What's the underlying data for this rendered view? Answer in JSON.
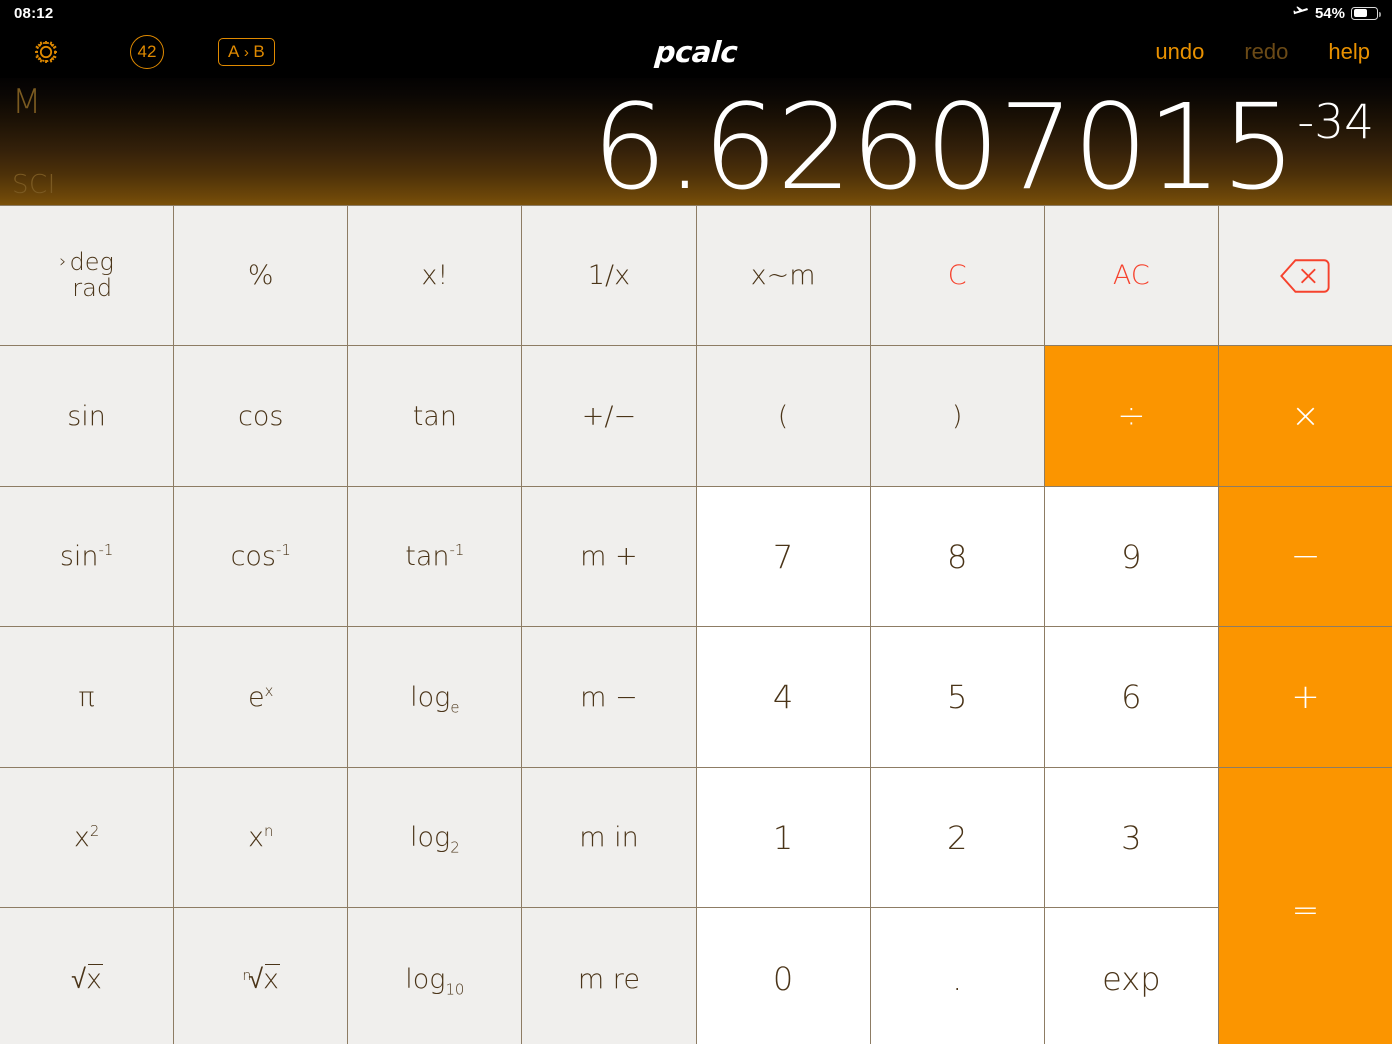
{
  "statusbar": {
    "clock": "08:12",
    "airplane_icon": "airplane-mode-icon",
    "battery_percent": "54%",
    "battery_level": 54
  },
  "toolbar": {
    "gear_icon": "gear-icon",
    "constants_badge": "42",
    "conversion_label_a": "A",
    "conversion_chevron": "›",
    "conversion_label_b": "B",
    "undo_label": "undo",
    "redo_label": "redo",
    "help_label": "help",
    "redo_disabled": true,
    "app_title": "pcalc"
  },
  "display": {
    "memory_indicator": "M",
    "mode_indicator": "SCI",
    "mantissa": "6.62607015",
    "exponent": "-34",
    "full_value": "6.62607015e-34"
  },
  "colors": {
    "accent_orange": "#fb9500",
    "toolbar_orange": "#e99100",
    "clear_red": "#f6422d",
    "key_face": "#f0efed",
    "num_key_face": "#ffffff",
    "key_text": "#4a3418",
    "grid_line": "#8d7c64",
    "display_top": "#030202",
    "display_bottom": "#7a5009"
  },
  "keypad": {
    "rows": [
      [
        {
          "name": "key-deg-rad",
          "type": "func",
          "mode_selected": "deg",
          "mode_other": "rad",
          "chevron": "›"
        },
        {
          "name": "key-percent",
          "type": "func",
          "label": "%"
        },
        {
          "name": "key-factorial",
          "type": "func",
          "label": "x!"
        },
        {
          "name": "key-reciprocal",
          "type": "func",
          "label": "1/x"
        },
        {
          "name": "key-swap-memory",
          "type": "func",
          "label": "x~m"
        },
        {
          "name": "key-clear",
          "type": "func",
          "label": "C",
          "style": "red"
        },
        {
          "name": "key-all-clear",
          "type": "func",
          "label": "AC",
          "style": "red"
        },
        {
          "name": "key-backspace",
          "type": "func",
          "label": "backspace-icon",
          "style": "red"
        }
      ],
      [
        {
          "name": "key-sin",
          "type": "func",
          "label": "sin"
        },
        {
          "name": "key-cos",
          "type": "func",
          "label": "cos"
        },
        {
          "name": "key-tan",
          "type": "func",
          "label": "tan"
        },
        {
          "name": "key-sign",
          "type": "func",
          "label": "+/−"
        },
        {
          "name": "key-paren-open",
          "type": "func",
          "label": "("
        },
        {
          "name": "key-paren-close",
          "type": "func",
          "label": ")"
        },
        {
          "name": "key-divide",
          "type": "op",
          "label": "÷"
        },
        {
          "name": "key-multiply",
          "type": "op",
          "label": "×"
        }
      ],
      [
        {
          "name": "key-asin",
          "type": "func",
          "label": "sin",
          "sup": "-1"
        },
        {
          "name": "key-acos",
          "type": "func",
          "label": "cos",
          "sup": "-1"
        },
        {
          "name": "key-atan",
          "type": "func",
          "label": "tan",
          "sup": "-1"
        },
        {
          "name": "key-memory-add",
          "type": "func",
          "label": "m +"
        },
        {
          "name": "key-7",
          "type": "num",
          "label": "7"
        },
        {
          "name": "key-8",
          "type": "num",
          "label": "8"
        },
        {
          "name": "key-9",
          "type": "num",
          "label": "9"
        },
        {
          "name": "key-subtract",
          "type": "op",
          "label": "−"
        }
      ],
      [
        {
          "name": "key-pi",
          "type": "func",
          "label": "π"
        },
        {
          "name": "key-exp-e",
          "type": "func",
          "label": "e",
          "sup": "x"
        },
        {
          "name": "key-log-e",
          "type": "func",
          "label": "log",
          "sub": "e"
        },
        {
          "name": "key-memory-subtract",
          "type": "func",
          "label": "m −"
        },
        {
          "name": "key-4",
          "type": "num",
          "label": "4"
        },
        {
          "name": "key-5",
          "type": "num",
          "label": "5"
        },
        {
          "name": "key-6",
          "type": "num",
          "label": "6"
        },
        {
          "name": "key-add",
          "type": "op",
          "label": "+"
        }
      ],
      [
        {
          "name": "key-square",
          "type": "func",
          "label": "x",
          "sup": "2"
        },
        {
          "name": "key-power",
          "type": "func",
          "label": "x",
          "sup": "n"
        },
        {
          "name": "key-log-2",
          "type": "func",
          "label": "log",
          "sub": "2"
        },
        {
          "name": "key-memory-in",
          "type": "func",
          "label": "m in"
        },
        {
          "name": "key-1",
          "type": "num",
          "label": "1"
        },
        {
          "name": "key-2",
          "type": "num",
          "label": "2"
        },
        {
          "name": "key-3",
          "type": "num",
          "label": "3"
        },
        {
          "name": "key-equals",
          "type": "op",
          "label": "=",
          "span2": true
        }
      ],
      [
        {
          "name": "key-sqrt",
          "type": "func",
          "label": "√x",
          "radical": "x"
        },
        {
          "name": "key-nth-root",
          "type": "func",
          "label": "ⁿ√x",
          "radical": "x",
          "index": "n"
        },
        {
          "name": "key-log-10",
          "type": "func",
          "label": "log",
          "sub": "10"
        },
        {
          "name": "key-memory-recall",
          "type": "func",
          "label": "m re"
        },
        {
          "name": "key-0",
          "type": "num",
          "label": "0"
        },
        {
          "name": "key-decimal",
          "type": "num",
          "label": "."
        },
        {
          "name": "key-exp",
          "type": "num",
          "label": "exp"
        }
      ]
    ]
  }
}
